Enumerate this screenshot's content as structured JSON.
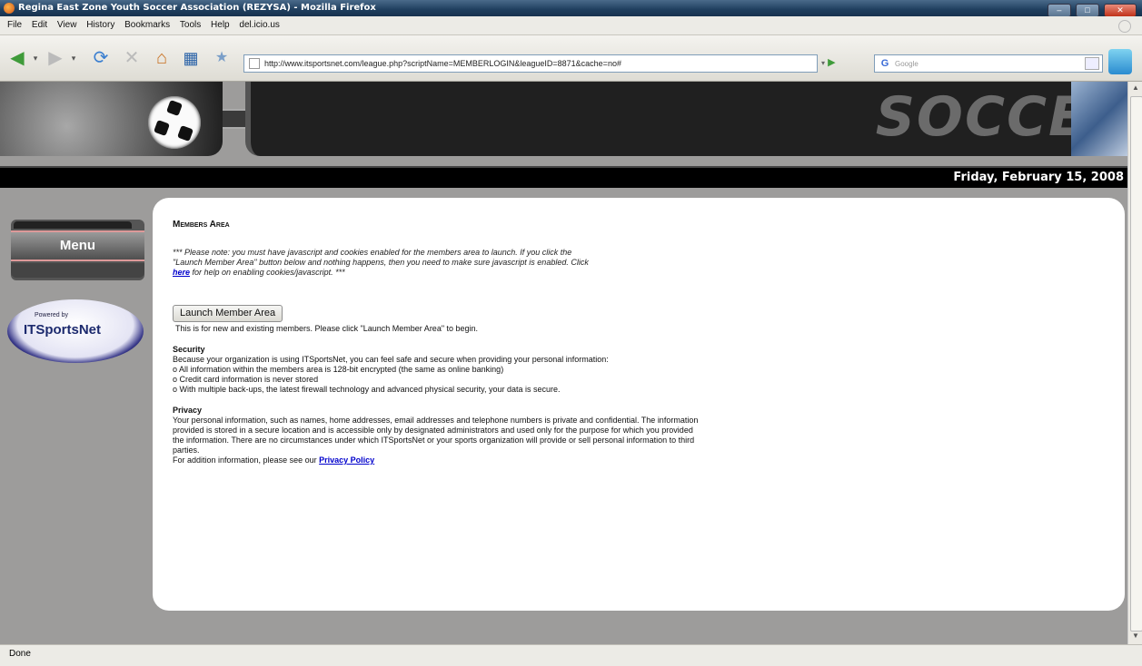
{
  "window": {
    "title": "Regina East Zone Youth Soccer Association (REZYSA) - Mozilla Firefox",
    "controls": {
      "minimize": "–",
      "maximize": "□",
      "close": "✕"
    }
  },
  "menu": {
    "items": [
      "File",
      "Edit",
      "View",
      "History",
      "Bookmarks",
      "Tools",
      "Help",
      "del.icio.us"
    ]
  },
  "toolbar": {
    "back_icon": "back-arrow-icon",
    "forward_icon": "forward-arrow-icon",
    "url": "http://www.itsportsnet.com/league.php?scriptName=MEMBERLOGIN&leagueID=8871&cache=no#",
    "search_placeholder": "Google",
    "search_engine_label": "G"
  },
  "header": {
    "banner_text": "SOCCE",
    "date": "Friday, February 15, 2008"
  },
  "sidebar": {
    "menu_label": "Menu",
    "powered_by": "Powered by",
    "powered_name": "ITSportsNet"
  },
  "main": {
    "heading": "Members Area",
    "note_before_link": "*** Please note: you must have javascript and cookies enabled for the members area to launch. If you click the \"Launch Member Area\" button below and nothing happens, then you need to make sure javascript is enabled. Click",
    "note_link": "here",
    "note_after_link": "for help on enabling cookies/javascript. ***",
    "launch_button": "Launch Member Area",
    "launch_subtext": "This is for new and existing members. Please click \"Launch Member Area\" to begin.",
    "security_title": "Security",
    "security_lines": [
      "Because your organization is using ITSportsNet, you can feel safe and secure when providing your personal information:",
      "o All information within the members area is 128-bit encrypted (the same as online banking)",
      "o Credit card information is never stored",
      "o With multiple back-ups, the latest firewall technology and advanced physical security, your data is secure."
    ],
    "privacy_title": "Privacy",
    "privacy_text": "Your personal information, such as names, home addresses, email addresses and telephone numbers is private and confidential. The information provided is stored in a secure location and is accessible only by designated administrators and used only for the purpose for which you provided the information. There are no circumstances under which ITSportsNet or your sports organization will provide or sell personal information to third parties.",
    "privacy_more_prefix": "For addition information, please see our",
    "privacy_policy_link": "Privacy Policy"
  },
  "status": {
    "text": "Done"
  }
}
